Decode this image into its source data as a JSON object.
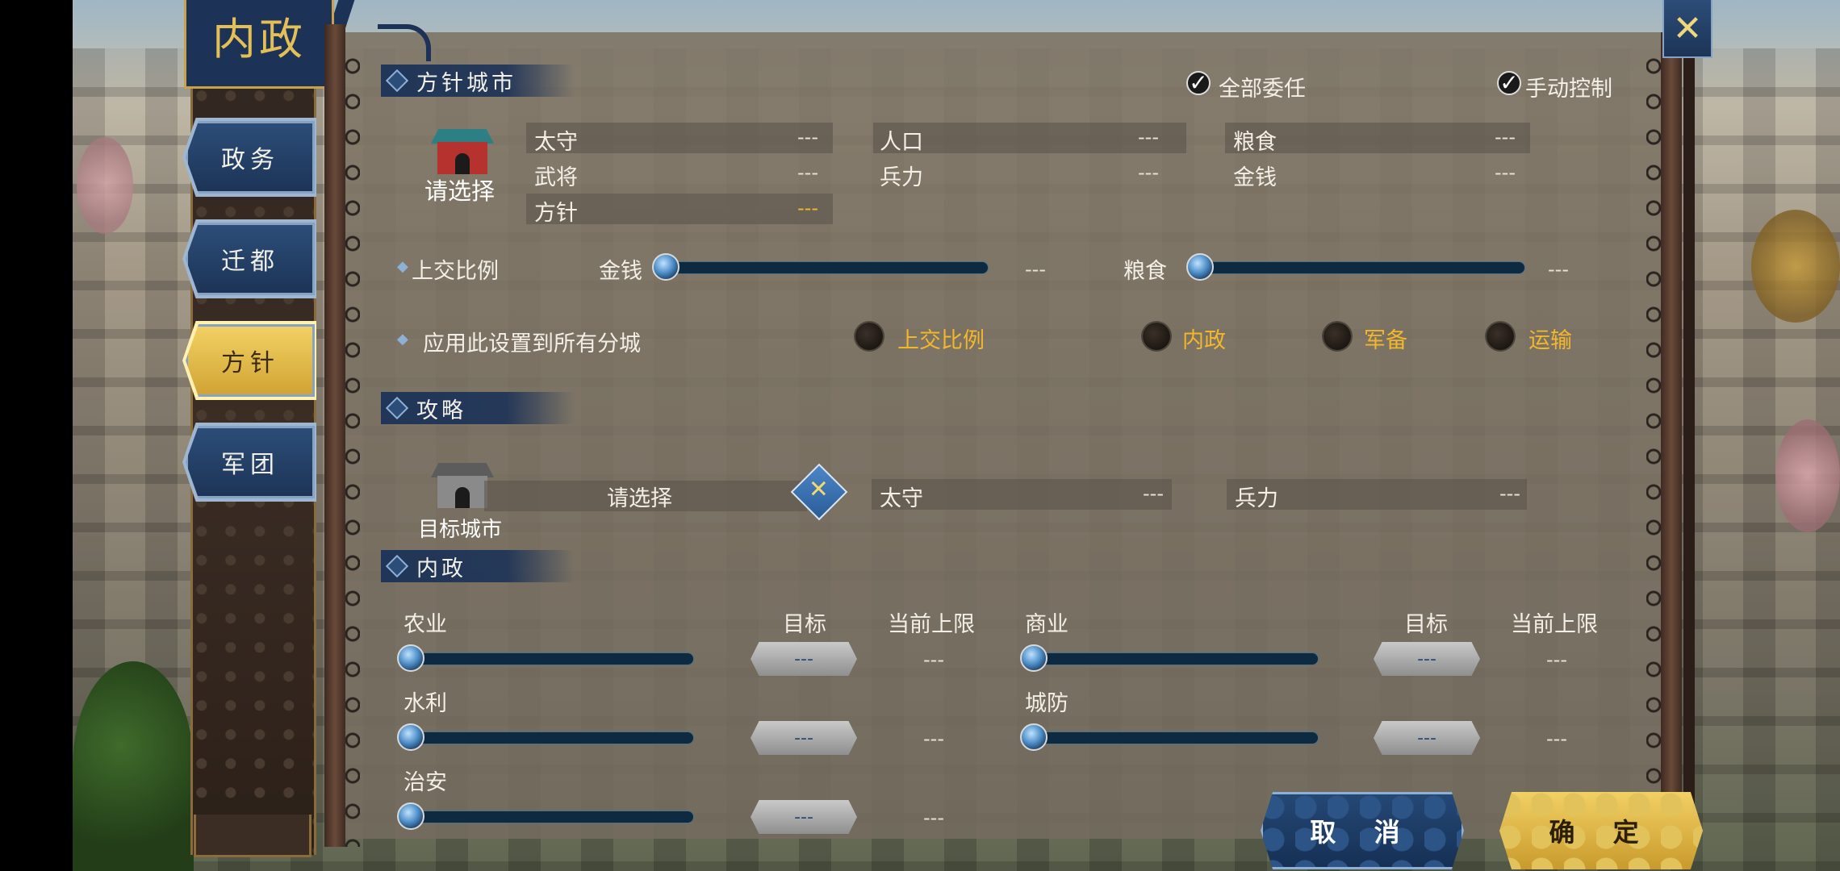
{
  "header": {
    "title": "内政",
    "close_icon": "close-x-icon"
  },
  "nav": {
    "items": [
      {
        "label": "政务",
        "active": false
      },
      {
        "label": "迁都",
        "active": false
      },
      {
        "label": "方针",
        "active": true
      },
      {
        "label": "军团",
        "active": false
      }
    ]
  },
  "policy_city": {
    "section_title": "方针城市",
    "delegate_all_label": "全部委任",
    "manual_control_label": "手动控制",
    "city_select_label": "请选择",
    "stats": {
      "governor_label": "太守",
      "governor_value": "---",
      "generals_label": "武将",
      "generals_value": "---",
      "policy_label": "方针",
      "policy_value": "---",
      "population_label": "人口",
      "population_value": "---",
      "troops_label": "兵力",
      "troops_value": "---",
      "food_label": "粮食",
      "food_value": "---",
      "money_label": "金钱",
      "money_value": "---"
    },
    "tribute": {
      "label": "上交比例",
      "money_label": "金钱",
      "money_value": "---",
      "food_label": "粮食",
      "food_value": "---"
    },
    "apply_all": {
      "label": "应用此设置到所有分城",
      "options": [
        "上交比例",
        "内政",
        "军备",
        "运输"
      ]
    }
  },
  "conquest": {
    "section_title": "攻略",
    "target_city_label": "目标城市",
    "select_label": "请选择",
    "governor_label": "太守",
    "governor_value": "---",
    "troops_label": "兵力",
    "troops_value": "---"
  },
  "domestic": {
    "section_title": "内政",
    "target_header": "目标",
    "cap_header": "当前上限",
    "rows": [
      {
        "name": "农业",
        "target": "---",
        "cap": "---"
      },
      {
        "name": "水利",
        "target": "---",
        "cap": "---"
      },
      {
        "name": "治安",
        "target": "---",
        "cap": "---"
      },
      {
        "name": "商业",
        "target": "---",
        "cap": "---"
      },
      {
        "name": "城防",
        "target": "---",
        "cap": "---"
      }
    ]
  },
  "footer": {
    "cancel_label": "取 消",
    "ok_label": "确 定"
  },
  "colors": {
    "panel_blue": "#1c3257",
    "accent_gold": "#f2b72b",
    "slider_track": "#0e2a40"
  }
}
